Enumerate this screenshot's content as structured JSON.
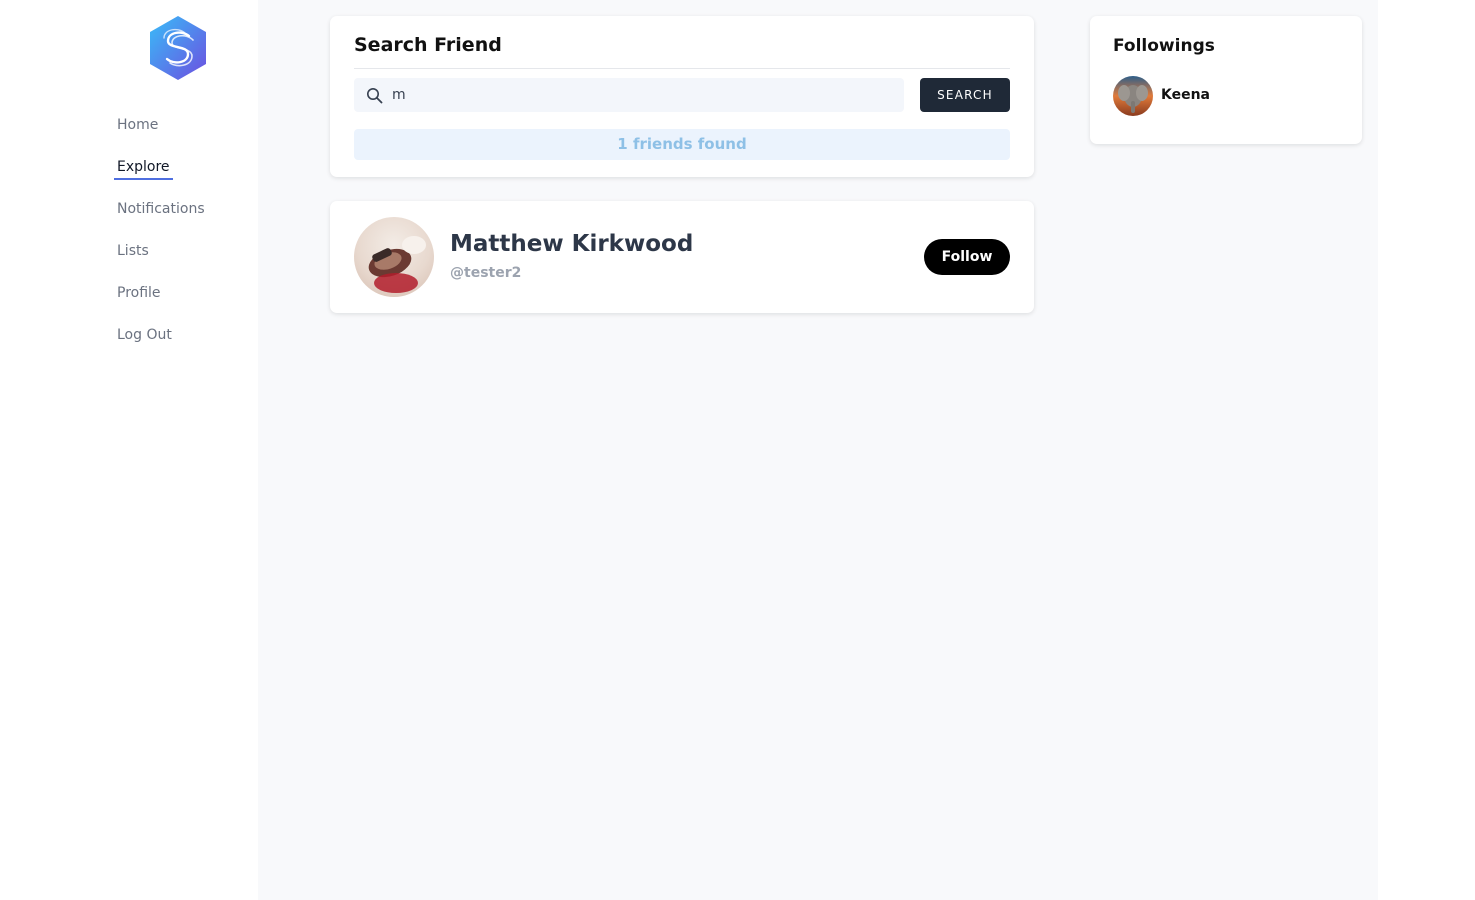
{
  "sidebar": {
    "logo": "hexagon-s-logo",
    "items": [
      {
        "label": "Home"
      },
      {
        "label": "Explore",
        "active": true
      },
      {
        "label": "Notifications"
      },
      {
        "label": "Lists"
      },
      {
        "label": "Profile"
      },
      {
        "label": "Log Out"
      }
    ]
  },
  "search": {
    "title": "Search Friend",
    "query": "m",
    "button_label": "SEARCH",
    "result_text": "1 friends found"
  },
  "results": [
    {
      "name": "Matthew Kirkwood",
      "handle": "@tester2",
      "button_label": "Follow"
    }
  ],
  "followings": {
    "title": "Followings",
    "items": [
      {
        "name": "Keena"
      }
    ]
  },
  "colors": {
    "accent": "#4f6fe0",
    "search_button": "#1f2937",
    "follow_button": "#000000",
    "result_text": "#8ec0e6",
    "result_bg": "#ebf3fd"
  }
}
